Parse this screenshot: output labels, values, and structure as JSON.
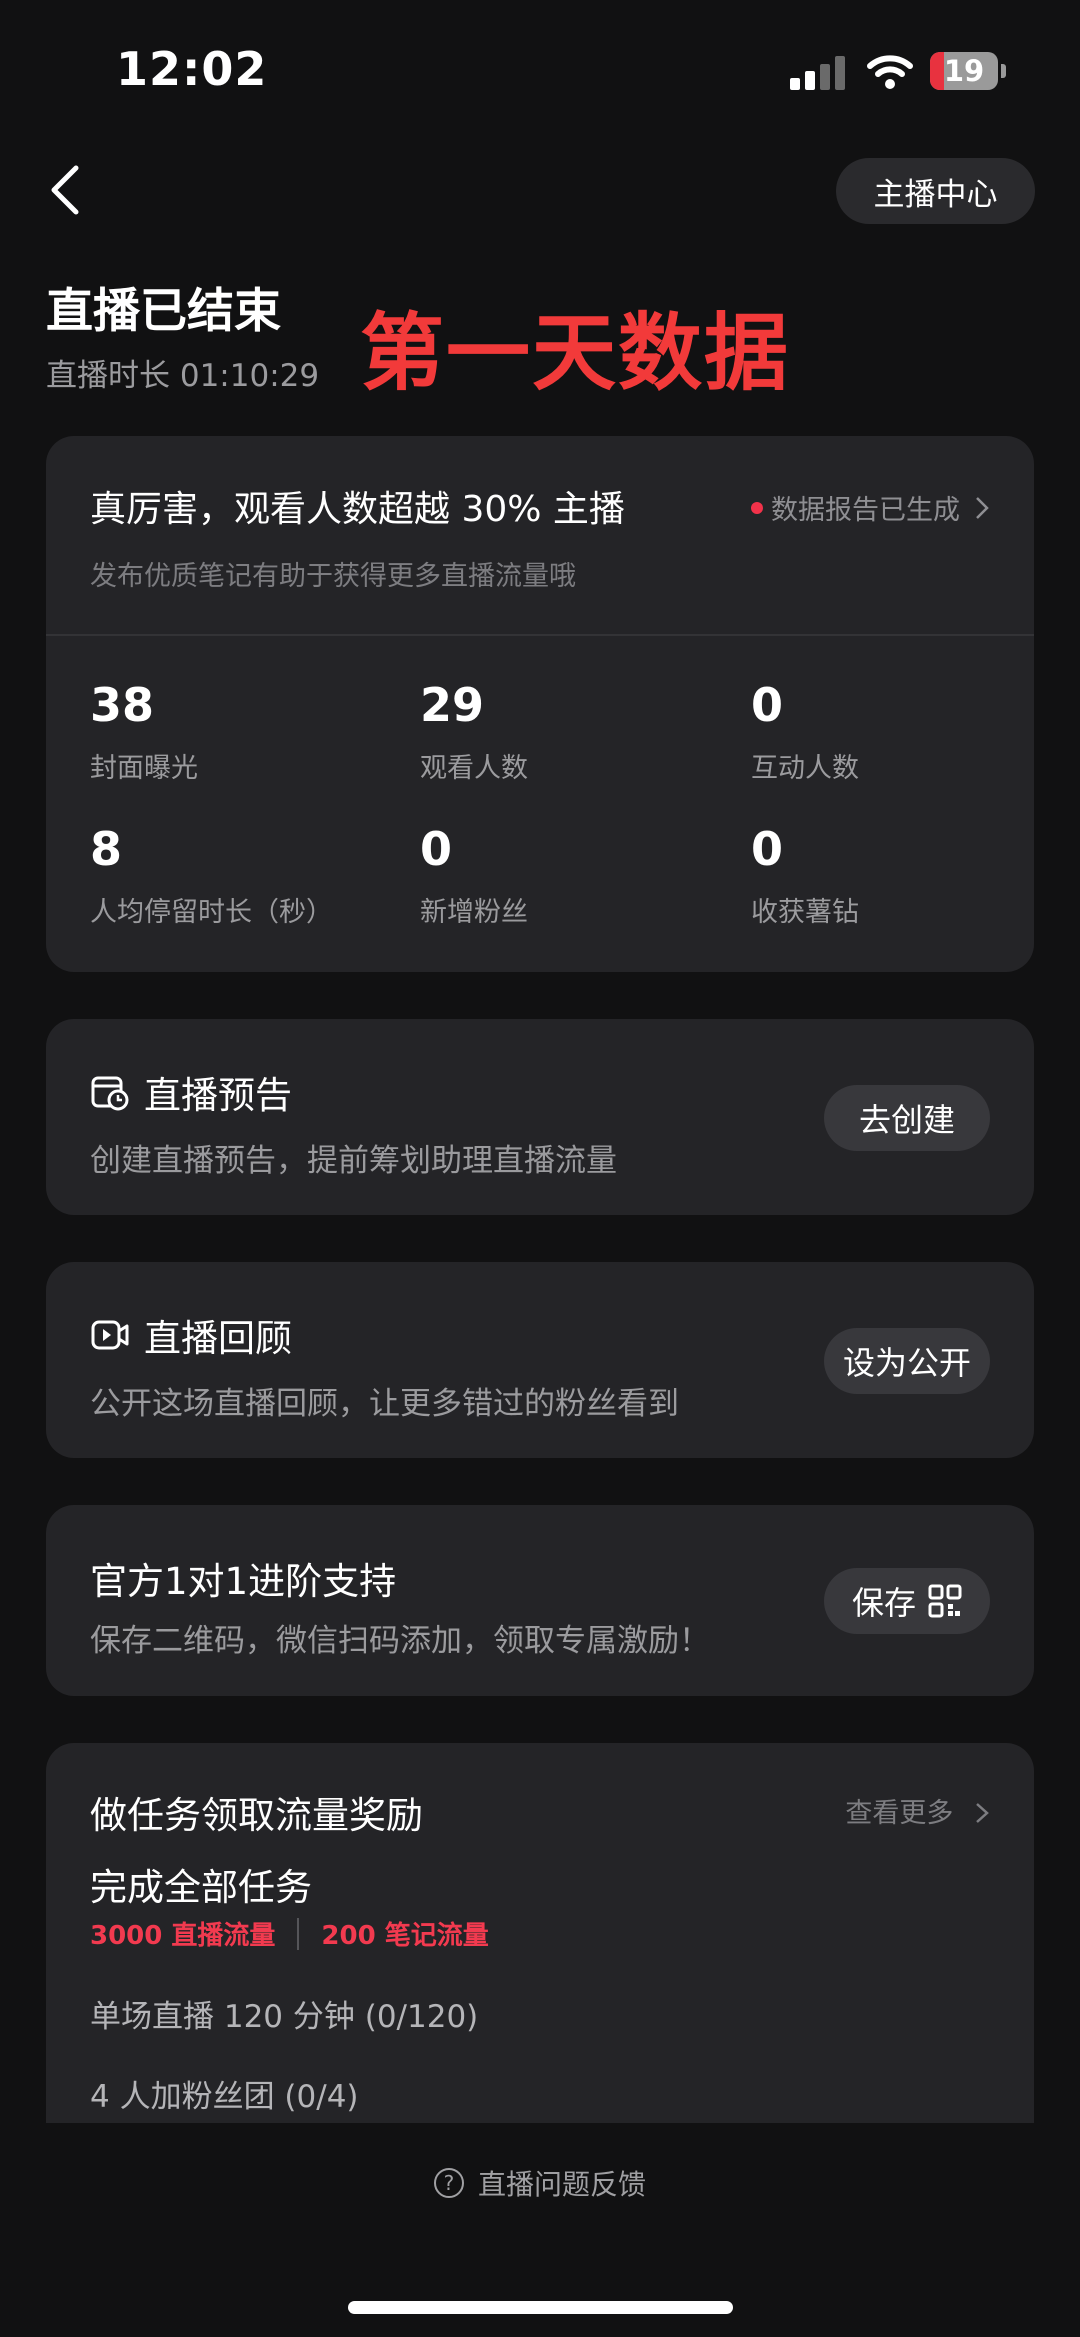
{
  "status_bar": {
    "time": "12:02",
    "battery": "19"
  },
  "nav": {
    "anchor_center": "主播中心"
  },
  "header": {
    "title": "直播已结束",
    "duration": "直播时长 01:10:29",
    "overlay": "第一天数据"
  },
  "summary": {
    "headline": "真厉害，观看人数超越 30% 主播",
    "report_link": "数据报告已生成",
    "subtext": "发布优质笔记有助于获得更多直播流量哦",
    "stats": [
      {
        "value": "38",
        "label": "封面曝光"
      },
      {
        "value": "29",
        "label": "观看人数"
      },
      {
        "value": "0",
        "label": "互动人数"
      },
      {
        "value": "8",
        "label": "人均停留时长（秒）"
      },
      {
        "value": "0",
        "label": "新增粉丝"
      },
      {
        "value": "0",
        "label": "收获薯钻"
      }
    ]
  },
  "preview": {
    "title": "直播预告",
    "desc": "创建直播预告，提前筹划助理直播流量",
    "button": "去创建"
  },
  "replay": {
    "title": "直播回顾",
    "desc": "公开这场直播回顾，让更多错过的粉丝看到",
    "button": "设为公开"
  },
  "support": {
    "title": "官方1对1进阶支持",
    "desc": "保存二维码，微信扫码添加，领取专属激励！",
    "button": "保存"
  },
  "tasks": {
    "title": "做任务领取流量奖励",
    "more": "查看更多",
    "all_title": "完成全部任务",
    "reward_live": "3000 直播流量",
    "reward_note": "200 笔记流量",
    "items": [
      "单场直播 120 分钟 (0/120)",
      "4 人加粉丝团 (0/4)"
    ]
  },
  "feedback": "直播问题反馈",
  "colors": {
    "background": "#111112",
    "card": "#242427",
    "accent_red": "#f23a3a"
  }
}
